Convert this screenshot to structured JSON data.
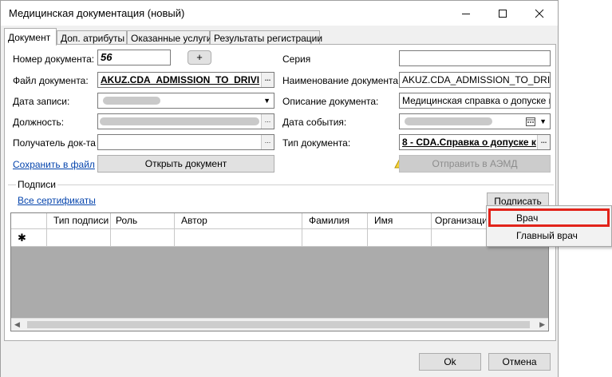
{
  "window": {
    "title": "Медицинская документация (новый)",
    "buttons": {
      "minimize": "—",
      "maximize": "☐",
      "close": "✕"
    }
  },
  "tabs": [
    "Документ",
    "Доп. атрибуты",
    "Оказанные услуги",
    "Результаты регистрации"
  ],
  "form": {
    "doc_number_label": "Номер документа:",
    "doc_number_value": "56",
    "add_button": "+",
    "series_label": "Серия",
    "series_value": "",
    "doc_file_label": "Файл документа:",
    "doc_file_value": "AKUZ.CDA_ADMISSION_TO_DRIVI",
    "doc_name_label": "Наименование документа:",
    "doc_name_value": "AKUZ.CDA_ADMISSION_TO_DRIVING",
    "record_date_label": "Дата записи:",
    "doc_desc_label": "Описание документа:",
    "doc_desc_value": "Медицинская справка о допуске к уп",
    "position_label": "Должность:",
    "event_date_label": "Дата события:",
    "recipient_label": "Получатель док-та",
    "recipient_value": "",
    "doc_type_label": "Тип документа:",
    "doc_type_value": "8 - CDA.Справка о допуске к",
    "ellipsis": "...",
    "save_link": "Сохранить в файл",
    "open_button": "Открыть документ",
    "send_button": "Отправить в АЭМД",
    "warning_icon": "warning-icon"
  },
  "signatures": {
    "group_title": "Подписи",
    "all_certs_link": "Все сертификаты",
    "sign_button": "Подписать",
    "columns": [
      "Тип подписи",
      "Роль",
      "Автор",
      "Фамилия",
      "Имя",
      "Организация"
    ],
    "new_row_marker": "✱"
  },
  "sign_menu": {
    "items": [
      "Врач",
      "Главный врач"
    ],
    "highlighted_color": "#e2231a"
  },
  "footer": {
    "ok_button": "Ok",
    "cancel_button": "Отмена"
  }
}
